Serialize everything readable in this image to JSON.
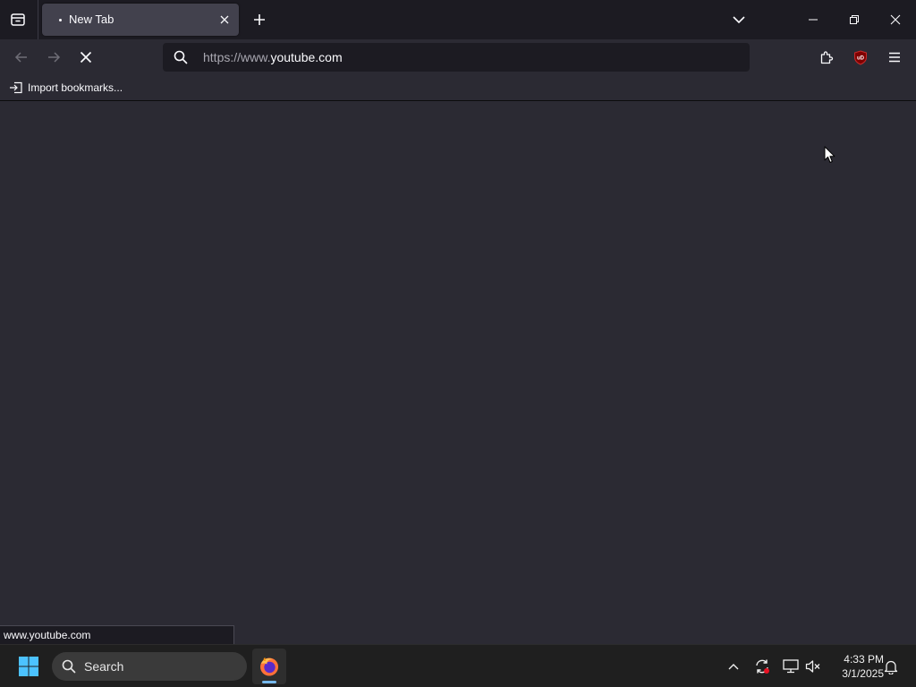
{
  "colors": {
    "content_bg": "#2b2a33",
    "tabstrip_bg": "#1c1b22",
    "active_tab_bg": "#42414d",
    "urlbar_bg": "#1c1b22",
    "taskbar_bg": "#1f1f1f",
    "windows_blue": "#4cc2ff"
  },
  "tabstrip": {
    "tab_list_icon": "firefox-view-icon",
    "tabs": [
      {
        "title": "New Tab",
        "active": true,
        "loading": true
      }
    ],
    "new_tab_icon": "plus-icon",
    "list_all_tabs_icon": "chevron-down-icon",
    "window_controls": [
      "minimize-icon",
      "restore-icon",
      "close-icon"
    ]
  },
  "navbar": {
    "back_icon": "arrow-left-icon",
    "forward_icon": "arrow-right-icon",
    "stop_icon": "stop-x-icon",
    "url_prefix": "https://www.",
    "url_domain": "youtube.com",
    "extensions_icon": "puzzle-icon",
    "ublock_icon": "ublock-origin-icon",
    "ublock_label": "uD",
    "menu_icon": "hamburger-icon"
  },
  "bookmarks_bar": {
    "import_label": "Import bookmarks..."
  },
  "status_panel": {
    "text": "www.youtube.com"
  },
  "taskbar": {
    "search_placeholder": "Search",
    "pinned_app": "firefox-icon",
    "tray_icons": [
      "chevron-up-icon",
      "sync-icon",
      "display-icon",
      "mute-icon"
    ],
    "time": "4:33 PM",
    "date": "3/1/2025",
    "notification_icon": "bell-icon"
  }
}
